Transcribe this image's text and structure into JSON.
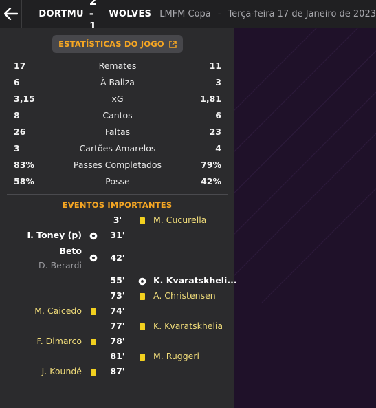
{
  "header": {
    "home_team": "DORTMU",
    "score": "2 - 1",
    "away_team": "WOLVES",
    "competition": "LMFM Copa",
    "separator": "-",
    "date": "Terça-feira 17 de Janeiro de 2023"
  },
  "stats_button": {
    "label": "ESTATÍSTICAS DO JOGO",
    "icon": "external-link-icon"
  },
  "stats": [
    {
      "label": "Remates",
      "home": "17",
      "away": "11"
    },
    {
      "label": "À Baliza",
      "home": "6",
      "away": "3"
    },
    {
      "label": "xG",
      "home": "3,15",
      "away": "1,81"
    },
    {
      "label": "Cantos",
      "home": "8",
      "away": "6"
    },
    {
      "label": "Faltas",
      "home": "26",
      "away": "23"
    },
    {
      "label": "Cartões Amarelos",
      "home": "3",
      "away": "4"
    },
    {
      "label": "Passes Completados",
      "home": "83%",
      "away": "79%"
    },
    {
      "label": "Posse",
      "home": "58%",
      "away": "42%"
    }
  ],
  "events_title": "EVENTOS IMPORTANTES",
  "events": [
    {
      "minute": "3'",
      "side": "away",
      "type": "yellow-card",
      "player": "M. Cucurella"
    },
    {
      "minute": "31'",
      "side": "home",
      "type": "goal",
      "player": "I. Toney (p)"
    },
    {
      "minute": "42'",
      "side": "home",
      "type": "goal",
      "player": "Beto",
      "assist": "D. Berardi"
    },
    {
      "minute": "55'",
      "side": "away",
      "type": "goal",
      "player": "K. Kvaratskheli..."
    },
    {
      "minute": "73'",
      "side": "away",
      "type": "yellow-card",
      "player": "A. Christensen"
    },
    {
      "minute": "74'",
      "side": "home",
      "type": "yellow-card",
      "player": "M. Caicedo"
    },
    {
      "minute": "77'",
      "side": "away",
      "type": "yellow-card",
      "player": "K. Kvaratskhelia"
    },
    {
      "minute": "78'",
      "side": "home",
      "type": "yellow-card",
      "player": "F. Dimarco"
    },
    {
      "minute": "81'",
      "side": "away",
      "type": "yellow-card",
      "player": "M. Ruggeri"
    },
    {
      "minute": "87'",
      "side": "home",
      "type": "yellow-card",
      "player": "J. Koundé"
    }
  ],
  "colors": {
    "accent": "#f5a623",
    "yellow_card": "#f2d01f",
    "background": "#2b2b2d",
    "header_bg": "#202022",
    "side_panel_bg": "#1f1129"
  }
}
